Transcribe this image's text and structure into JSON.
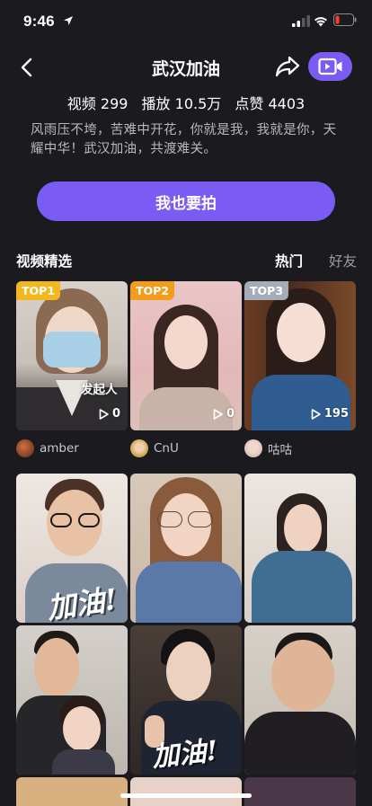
{
  "status_bar": {
    "time": "9:46"
  },
  "header": {
    "title": "武汉加油"
  },
  "stats": {
    "videos_label": "视频",
    "videos_value": "299",
    "plays_label": "播放",
    "plays_value": "10.5万",
    "likes_label": "点赞",
    "likes_value": "4403"
  },
  "description": "风雨压不垮，苦难中开花，你就是我，我就是你，天耀中华！武汉加油，共渡难关。",
  "cta_label": "我也要拍",
  "section": {
    "title": "视频精选",
    "tab_hot": "热门",
    "tab_friends": "好友"
  },
  "top_videos": [
    {
      "badge": "TOP1",
      "plays": "0",
      "tag": "发起人",
      "author": "amber",
      "badge_color": "#f5b81c"
    },
    {
      "badge": "TOP2",
      "plays": "0",
      "author": "CnU",
      "badge_color": "#f59c1a"
    },
    {
      "badge": "TOP3",
      "plays": "195",
      "author": "咕咕",
      "badge_color": "#a6abb8"
    }
  ],
  "overlay_text": {
    "row2_left": "加油!",
    "row3_middle": "加油!"
  },
  "colors": {
    "accent": "#7a5cf5",
    "background": "#1b1b1f"
  }
}
